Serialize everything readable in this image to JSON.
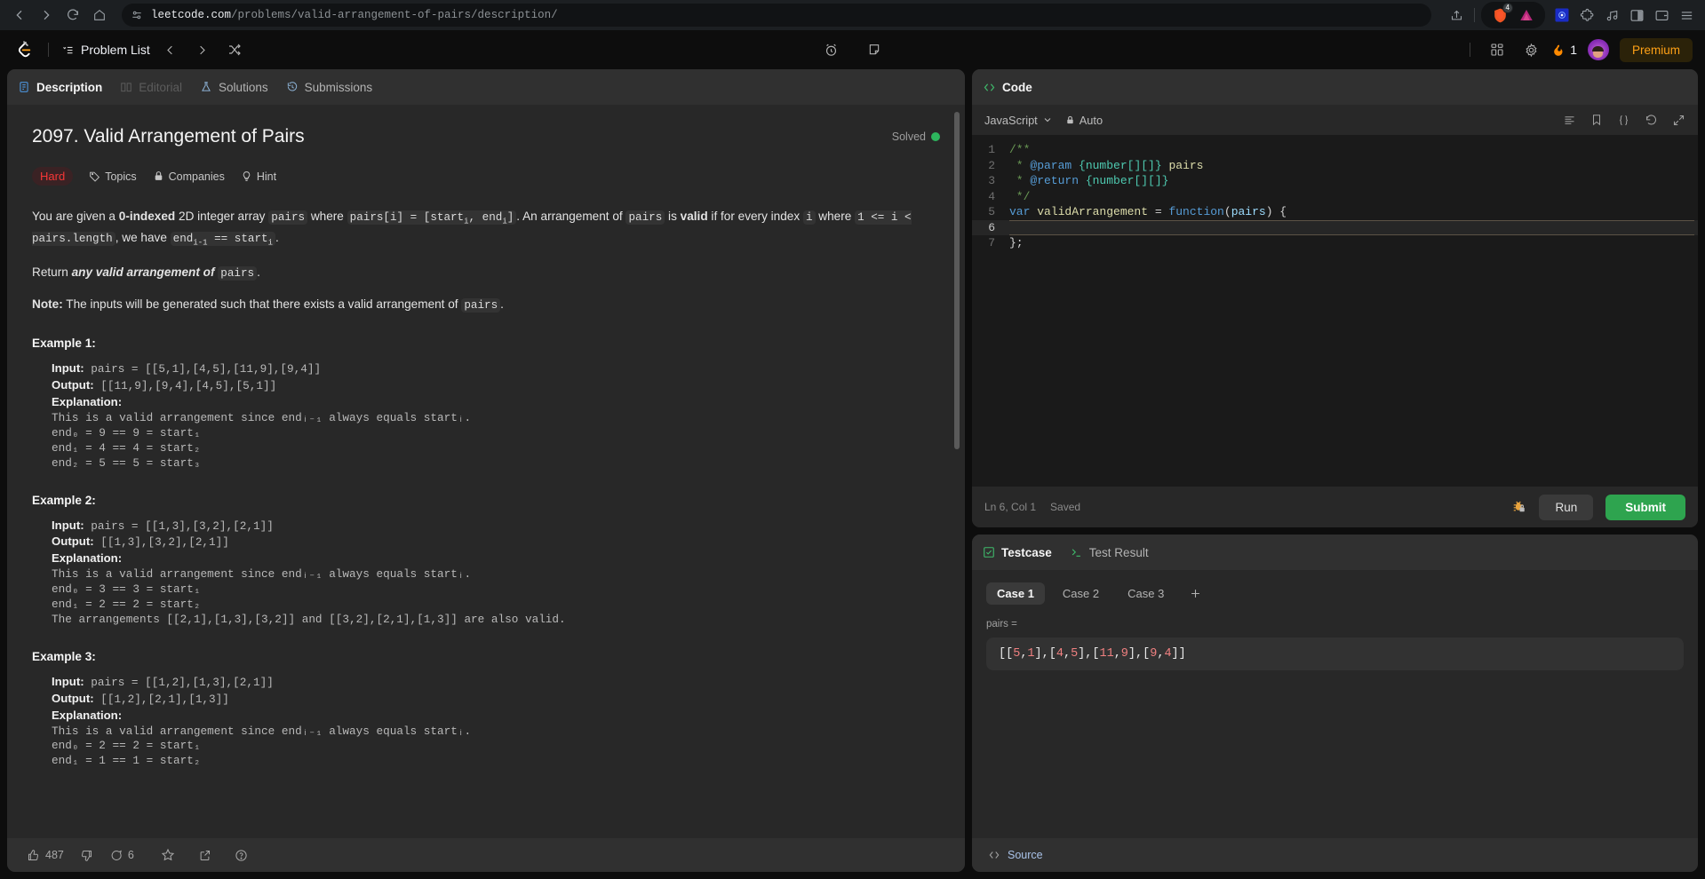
{
  "browser": {
    "url_domain": "leetcode.com",
    "url_path": "/problems/valid-arrangement-of-pairs/description/",
    "back_icon": "back-arrow-icon",
    "forward_icon": "forward-arrow-icon",
    "reload_icon": "reload-icon",
    "home_icon": "home-icon",
    "site_info_icon": "site-settings-icon",
    "share_icon": "share-icon",
    "brave_shield_badge": "4",
    "extensions": [
      "brave-shield-icon",
      "triangle-extension-icon",
      "blue-star-extension-icon",
      "puzzle-extension-icon",
      "music-extension-icon",
      "sidebar-icon",
      "wallet-icon",
      "menu-icon"
    ]
  },
  "lc_header": {
    "problem_list_label": "Problem List",
    "prev_icon": "chevron-left-icon",
    "next_icon": "chevron-right-icon",
    "shuffle_icon": "shuffle-icon",
    "timer_icon": "alarm-clock-icon",
    "note_icon": "note-icon",
    "grid_icon": "grid-apps-icon",
    "settings_icon": "gear-icon",
    "streak_count": "1",
    "streak_icon": "fire-icon",
    "premium_label": "Premium"
  },
  "description": {
    "tabs": [
      {
        "label": "Description",
        "icon": "document-icon",
        "state": "active"
      },
      {
        "label": "Editorial",
        "icon": "book-icon",
        "state": "disabled"
      },
      {
        "label": "Solutions",
        "icon": "flask-icon",
        "state": "normal"
      },
      {
        "label": "Submissions",
        "icon": "history-icon",
        "state": "normal"
      }
    ],
    "title": "2097. Valid Arrangement of Pairs",
    "solved_label": "Solved",
    "difficulty": "Hard",
    "meta_links": [
      {
        "label": "Topics",
        "icon": "tag-icon"
      },
      {
        "label": "Companies",
        "icon": "lock-icon"
      },
      {
        "label": "Hint",
        "icon": "lightbulb-icon"
      }
    ],
    "para1_a": "You are given a ",
    "para1_bold0": "0-indexed",
    "para1_b": " 2D integer array ",
    "para1_code1": "pairs",
    "para1_c": " where ",
    "para1_code2": "pairs[i] = [start",
    "para1_d": "]",
    "para1_e": ". An arrangement of ",
    "para1_code3": "pairs",
    "para1_f": " is ",
    "para1_boldvalid": "valid",
    "para1_g": " if for every index ",
    "para1_code4": "i",
    "para1_h": " where ",
    "para1_code5": "1 <= i < pairs.length",
    "para1_i": ", we have ",
    "para1_code6": "end",
    "para1_j": " == start",
    "para2_a": "Return ",
    "para2_em": "any valid arrangement of ",
    "para2_code": "pairs",
    "para2_end": ".",
    "note_label": "Note:",
    "note_text": " The inputs will be generated such that there exists a valid arrangement of ",
    "note_code": "pairs",
    "examples": [
      {
        "title": "Example 1:",
        "input_label": "Input:",
        "input_value": " pairs = [[5,1],[4,5],[11,9],[9,4]]",
        "output_label": "Output:",
        "output_value": " [[11,9],[9,4],[4,5],[5,1]]",
        "explanation_label": "Explanation:",
        "explanation_lines": [
          "This is a valid arrangement since endᵢ₋₁ always equals startᵢ.",
          "end₀ = 9 == 9 = start₁",
          "end₁ = 4 == 4 = start₂",
          "end₂ = 5 == 5 = start₃"
        ]
      },
      {
        "title": "Example 2:",
        "input_label": "Input:",
        "input_value": " pairs = [[1,3],[3,2],[2,1]]",
        "output_label": "Output:",
        "output_value": " [[1,3],[3,2],[2,1]]",
        "explanation_label": "Explanation:",
        "explanation_lines": [
          "This is a valid arrangement since endᵢ₋₁ always equals startᵢ.",
          "end₀ = 3 == 3 = start₁",
          "end₁ = 2 == 2 = start₂",
          "The arrangements [[2,1],[1,3],[3,2]] and [[3,2],[2,1],[1,3]] are also valid."
        ]
      },
      {
        "title": "Example 3:",
        "input_label": "Input:",
        "input_value": " pairs = [[1,2],[1,3],[2,1]]",
        "output_label": "Output:",
        "output_value": " [[1,2],[2,1],[1,3]]",
        "explanation_label": "Explanation:",
        "explanation_lines": [
          "This is a valid arrangement since endᵢ₋₁ always equals startᵢ.",
          "end₀ = 2 == 2 = start₁",
          "end₁ = 1 == 1 = start₂"
        ]
      }
    ],
    "footer": {
      "upvote_count": "487",
      "upvote_icon": "thumbs-up-icon",
      "downvote_icon": "thumbs-down-icon",
      "comment_count": "6",
      "comment_icon": "comment-icon",
      "star_icon": "star-icon",
      "share_icon": "share-external-icon",
      "help_icon": "help-circle-icon"
    }
  },
  "code": {
    "panel_title": "Code",
    "panel_icon": "code-brackets-icon",
    "language": "JavaScript",
    "language_chevron": "chevron-down-icon",
    "auto_label": "Auto",
    "auto_icon": "lock-icon",
    "toolbar_icons": [
      "format-lines-icon",
      "bookmark-icon",
      "curly-braces-icon",
      "reset-undo-icon",
      "fullscreen-expand-icon"
    ],
    "lines": [
      {
        "n": "1",
        "html": "<span class=\"c-com\">/**</span>"
      },
      {
        "n": "2",
        "html": "<span class=\"c-com\"> * </span><span class=\"c-tag\">@param</span><span class=\"c-com\"> </span><span class=\"c-typ\">{number[][]}</span><span class=\"c-com\"> </span><span class=\"c-fn\">pairs</span>"
      },
      {
        "n": "3",
        "html": "<span class=\"c-com\"> * </span><span class=\"c-tag\">@return</span><span class=\"c-com\"> </span><span class=\"c-typ\">{number[][]}</span>"
      },
      {
        "n": "4",
        "html": "<span class=\"c-com\"> */</span>"
      },
      {
        "n": "5",
        "html": "<span class=\"c-kw\">var</span><span class=\"c-pun\"> </span><span class=\"c-fn\">validArrangement</span><span class=\"c-pun\"> = </span><span class=\"c-kw\">function</span><span class=\"c-pun\">(</span><span class=\"c-var\">pairs</span><span class=\"c-pun\">) {</span>"
      },
      {
        "n": "6",
        "html": "",
        "current": true
      },
      {
        "n": "7",
        "html": "<span class=\"c-pun\">};</span>"
      }
    ],
    "cursor_position": "Ln 6, Col 1",
    "save_status": "Saved",
    "debug_icon": "debug-locked-icon",
    "run_label": "Run",
    "submit_label": "Submit"
  },
  "testcase": {
    "tabs": [
      {
        "label": "Testcase",
        "icon": "checkbox-checked-icon",
        "state": "active"
      },
      {
        "label": "Test Result",
        "icon": "terminal-prompt-icon",
        "state": "normal"
      }
    ],
    "cases": [
      "Case 1",
      "Case 2",
      "Case 3"
    ],
    "active_case": "Case 1",
    "add_case_icon": "plus-icon",
    "param_label": "pairs =",
    "param_value": "[[5,1],[4,5],[11,9],[9,4]]",
    "source_label": "Source",
    "source_icon": "code-brackets-icon"
  },
  "colors": {
    "accent_orange": "#ffa116",
    "hard_red": "#f63737",
    "solved_green": "#2db55d",
    "submit_green": "#2ea44f",
    "panel_bg": "#282828",
    "editor_bg": "#1a1a1a"
  }
}
